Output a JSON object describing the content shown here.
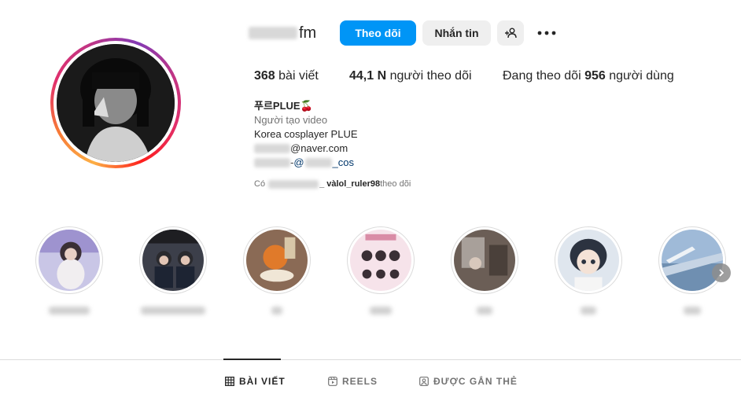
{
  "profile": {
    "username_visible_suffix": "fm",
    "follow_label": "Theo dõi",
    "message_label": "Nhắn tin",
    "add_user_icon": "add-user-icon",
    "more_icon": "more-options-icon"
  },
  "stats": {
    "posts_count": "368",
    "posts_label": " bài viết",
    "followers_count": "44,1 N",
    "followers_label": " người theo dõi",
    "following_prefix": "Đang theo dõi ",
    "following_count": "956",
    "following_label": " người dùng"
  },
  "bio": {
    "name": "푸르PLUE",
    "name_emoji": "🍒",
    "category": "Người tạo video",
    "line1": "Korea cosplayer PLUE",
    "email_suffix": "@naver.com",
    "ig_dash": "- ",
    "ig_at": "@",
    "ig_suffix": "_cos"
  },
  "followed_by": {
    "prefix": "Có",
    "separator": "_ và ",
    "user2": "lol_ruler98",
    "suffix": " theo dõi"
  },
  "tabs": {
    "posts": "BÀI VIẾT",
    "reels": "REELS",
    "tagged": "ĐƯỢC GẮN THẺ"
  },
  "colors": {
    "primary_button": "#0095f6",
    "secondary_button": "#efefef",
    "text": "#262626",
    "muted": "#737373"
  }
}
